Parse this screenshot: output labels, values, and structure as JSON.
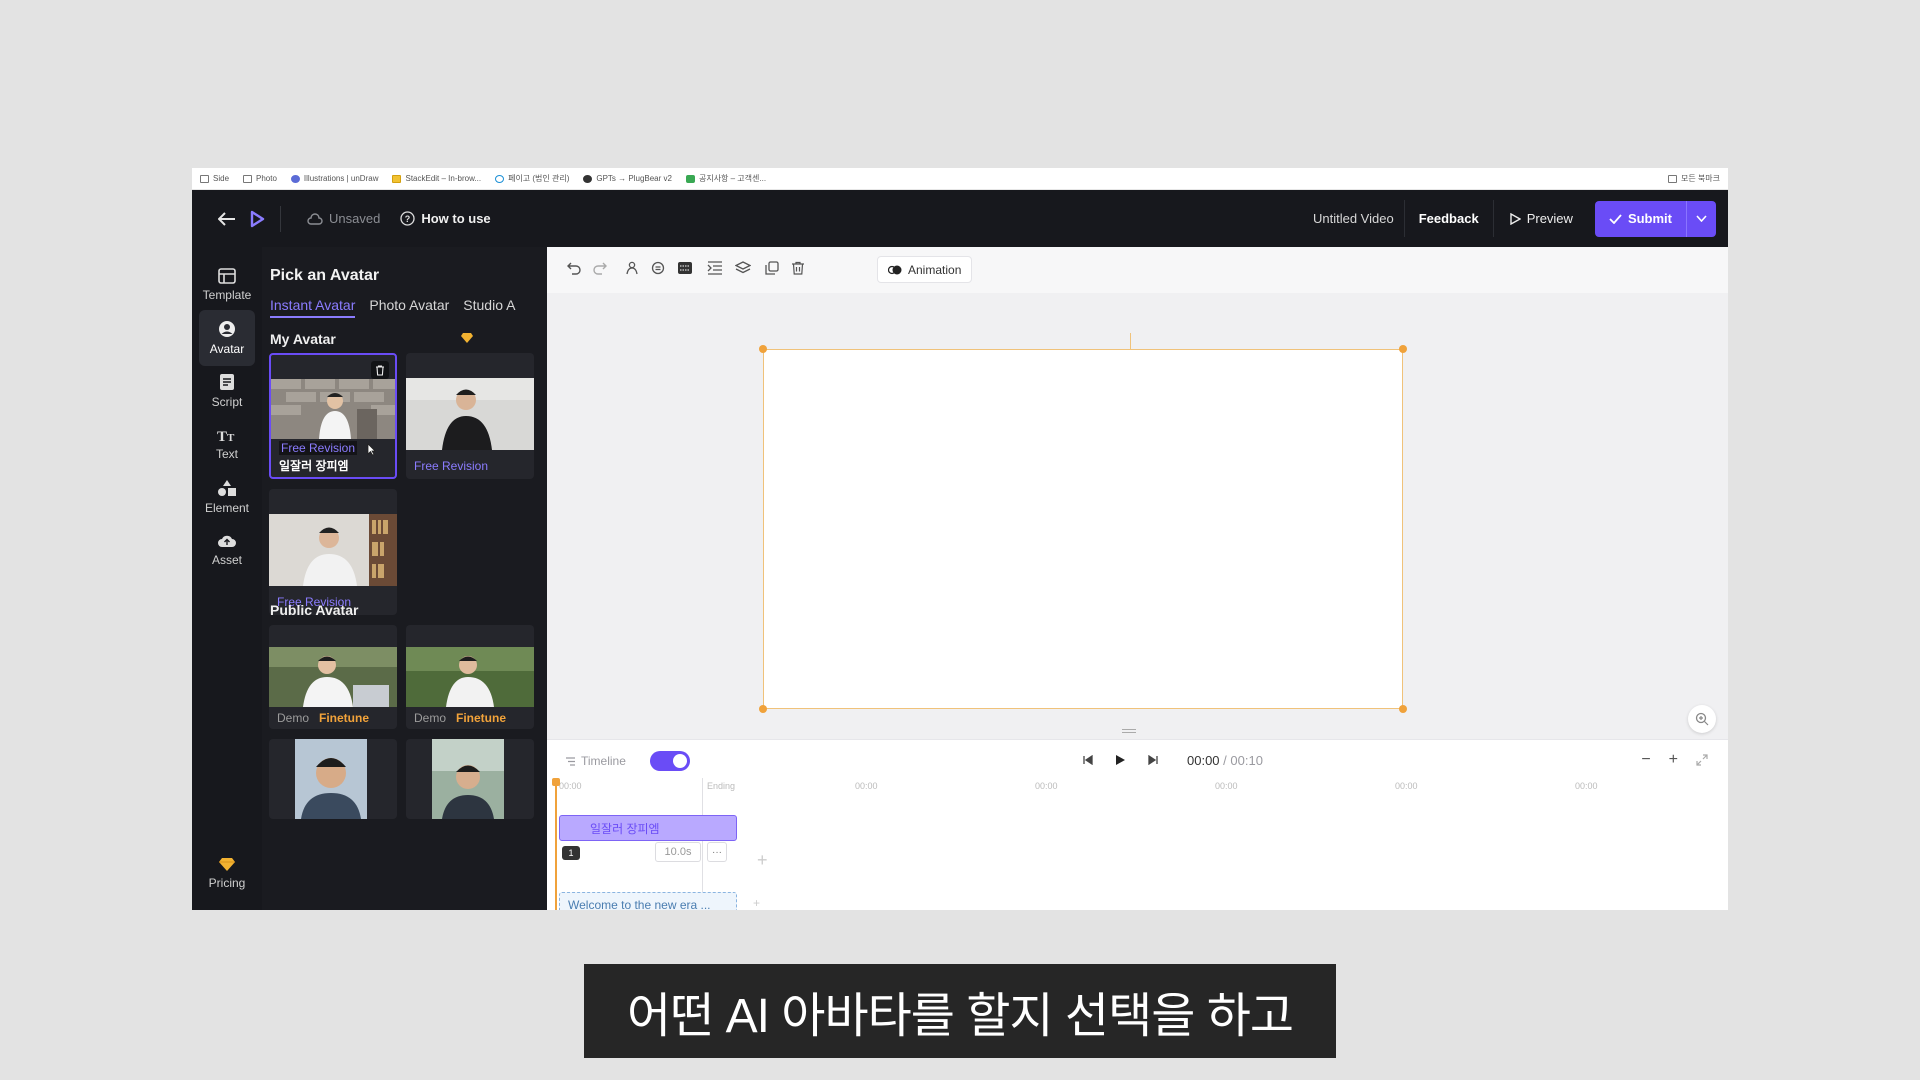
{
  "bookmarks": [
    {
      "label": "Side",
      "icon": "folder-icon"
    },
    {
      "label": "Photo",
      "icon": "folder-icon"
    },
    {
      "label": "Illustrations | unDraw",
      "icon": "undraw-icon"
    },
    {
      "label": "StackEdit – In-brow...",
      "icon": "stackedit-icon"
    },
    {
      "label": "페이고 (법인 관리)",
      "icon": "paygo-icon"
    },
    {
      "label": "GPTs → PlugBear v2",
      "icon": "gpt-icon"
    },
    {
      "label": "공지사항 – 고객센...",
      "icon": "notice-icon"
    }
  ],
  "bookmarks_right": "모든 북마크",
  "header": {
    "unsaved": "Unsaved",
    "how_to_use": "How to use",
    "video_title": "Untitled Video",
    "feedback": "Feedback",
    "preview": "Preview",
    "submit": "Submit"
  },
  "nav": [
    {
      "label": "Template",
      "icon": "template-icon"
    },
    {
      "label": "Avatar",
      "icon": "avatar-icon"
    },
    {
      "label": "Script",
      "icon": "script-icon"
    },
    {
      "label": "Text",
      "icon": "text-icon"
    },
    {
      "label": "Element",
      "icon": "element-icon"
    },
    {
      "label": "Asset",
      "icon": "asset-icon"
    }
  ],
  "pricing": "Pricing",
  "panel": {
    "title": "Pick an Avatar",
    "tabs": [
      "Instant Avatar",
      "Photo Avatar",
      "Studio A"
    ],
    "active_tab": "Instant Avatar",
    "my_avatar": "My Avatar",
    "public_avatar": "Public Avatar",
    "my_avatars": [
      {
        "badge": "Free Revision",
        "name": "일잘러 장피엠",
        "selected": true
      },
      {
        "badge": "Free Revision",
        "name": ""
      },
      {
        "badge": "Free Revision",
        "name": ""
      }
    ],
    "public_avatars": [
      {
        "demo": "Demo",
        "finetune": "Finetune"
      },
      {
        "demo": "Demo",
        "finetune": "Finetune"
      }
    ]
  },
  "toolbar": {
    "animation": "Animation"
  },
  "timeline": {
    "label": "Timeline",
    "current": "00:00",
    "total": "/ 00:10",
    "ruler_start": "00:00",
    "ruler_ending": "Ending",
    "ruler_ticks": [
      "00:00",
      "00:00",
      "00:00",
      "00:00",
      "00:00"
    ],
    "avatar_clip": "일잘러 장피엠",
    "scene_number": "1",
    "duration": "10.0s",
    "more": "···",
    "script_clip": "Welcome to the new era ..."
  },
  "subtitle": "어떤 AI 아바타를 할지 선택을 하고",
  "colors": {
    "accent": "#6a4cf6",
    "dark_bg": "#17181d",
    "canvas_border": "#f0c27a",
    "finetune": "#f2a33a"
  }
}
